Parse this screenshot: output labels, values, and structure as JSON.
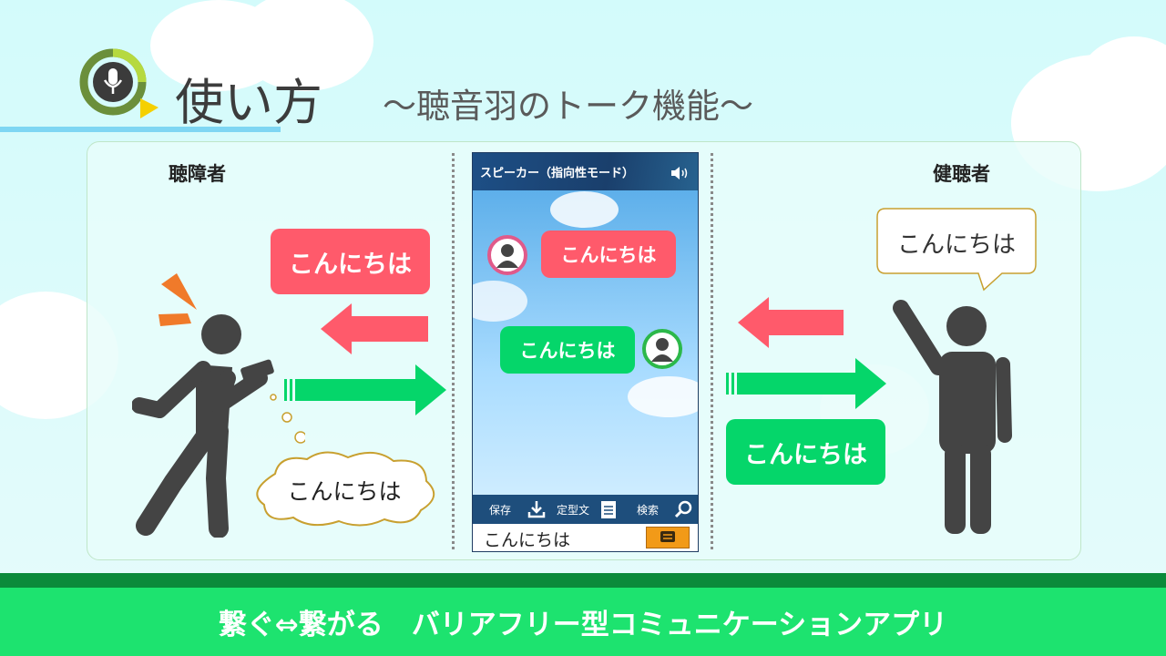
{
  "header": {
    "title": "使い方",
    "subtitle": "〜聴音羽のトーク機能〜"
  },
  "labels": {
    "left_person": "聴障者",
    "right_person": "健聴者"
  },
  "bubbles": {
    "left_received": "こんにちは",
    "left_thought": "こんにちは",
    "right_speech": "こんにちは",
    "right_sent": "こんにちは"
  },
  "phone": {
    "mode_title": "スピーカー（指向性モード）",
    "msg_incoming": "こんにちは",
    "msg_outgoing": "こんにちは",
    "toolbar": {
      "save": "保存",
      "template": "定型文",
      "search": "検索"
    },
    "input_value": "こんにちは"
  },
  "footer": {
    "tagline": "繋ぐ⇔繋がる　バリアフリー型コミュニケーションアプリ"
  },
  "colors": {
    "red": "#ff5a6b",
    "green": "#05d66a",
    "footer": "#1de36f",
    "accent_blue": "#7ed6f3"
  }
}
